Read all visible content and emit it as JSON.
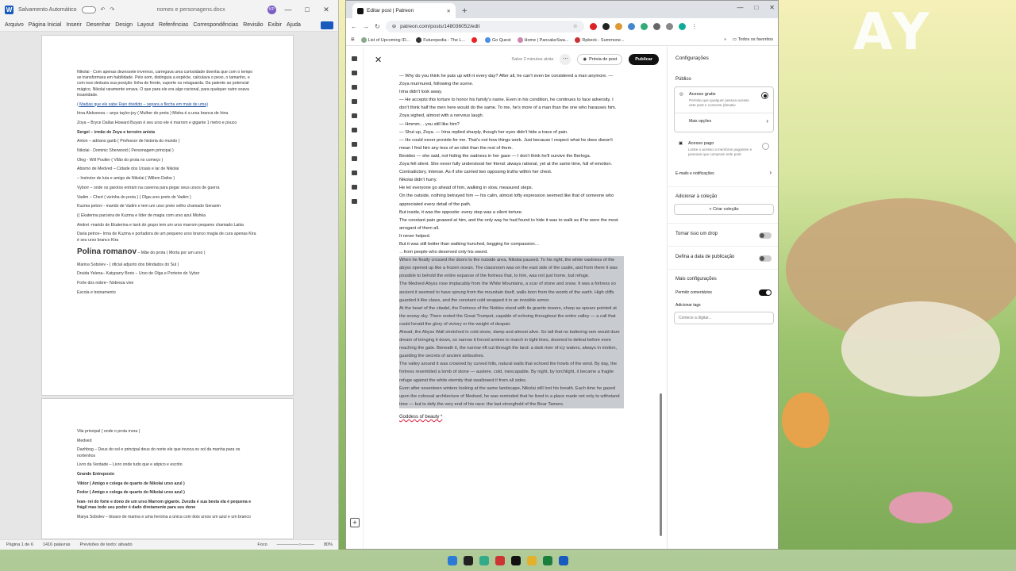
{
  "word": {
    "autosave_label": "Salvamento Automático",
    "doc_title": "nomes e personagens.docx",
    "user_initials": "KP",
    "menu": [
      "Arquivo",
      "Página Inicial",
      "Inserir",
      "Desenhar",
      "Design",
      "Layout",
      "Referências",
      "Correspondências",
      "Revisão",
      "Exibir",
      "Ajuda"
    ],
    "page1": [
      {
        "t": "Nikolai - Com apenas dezessete invernos, carregava uma curiosidade doentia que com o tempo se transformara em habilidade. Pelo som, distinguia a espécie, calculava o peso, o tamanho, e com isso deduzia sua posição: linha de frente, suporte ou retaguarda. Da patente ao potencial mágico, Nikolai raramente errava. O que para ele era algo racional, para qualquer outro soava insanidade.",
        "c": ""
      },
      {
        "t": "( Madias que ele sabe Raio dividido – separa a flecha em mais de uma)",
        "c": "u"
      },
      {
        "t": "Irina Aleksееva – anya taylor-joy  ( Mulher do prota )  Misha é a ursa branca de Irina",
        "c": ""
      },
      {
        "t": "Zoya – Bryce Dallas Howard  Buyan é seu urso ele é marrom e gigante 1 metro e pouco",
        "c": ""
      },
      {
        "t": "Sergei – irmão de Zoya e terceiro anista",
        "c": "b"
      },
      {
        "t": "Anton – adriano garib ( Professor de historia do mundo )",
        "c": ""
      },
      {
        "t": "Nikolai - Dominic Sherwood  ( Personagem principal )",
        "c": ""
      },
      {
        "t": "Oleg - Will Poulter ( Vilão do prota no começo )",
        "c": ""
      },
      {
        "t": "Abismo de Medved – Cidade dos Ursais e lar de Nikolai",
        "c": ""
      },
      {
        "t": "– Instrutor de luta e amigo de Nikolai ( Willem Dafoe )",
        "c": ""
      },
      {
        "t": "Vyborr – onde os garotos entram na caverna para pegar seus ursos de guerra",
        "c": ""
      },
      {
        "t": "Vadim – Chert ( vizinha do prota ) ( Olga urso preto de Vadim )",
        "c": ""
      },
      {
        "t": "Kuzma petrov - marido de Vadim e tem um urso preto velho chamado Gerasim",
        "c": ""
      },
      {
        "t": "(( Ekaterina  parceira de Kuzma e líder de magia com urso azul  Mishka",
        "c": ""
      },
      {
        "t": "   Andrei  -marido de Ekaterina e tank do grupo tem um urso marrom pequeno chamado Laika",
        "c": ""
      },
      {
        "t": " Daria petrov– Irma de Kuzma e portadora de um pequeno urso branco magia de cura apenas Kira é seu urso branco Kira",
        "c": ""
      },
      {
        "t": "Polina romanov",
        "c": "h",
        "s": " – Mãe do prota ( Morta por um urso )"
      },
      {
        "t": "Marina Sobolev -       ( oficial adjunto dos blindados do Sul )",
        "c": ""
      },
      {
        "t": "Druida Yelena– Katyparry  Boris – Urso de Olga e Porteiro do Vybor",
        "c": ""
      },
      {
        "t": "Forte dos nobre– Nobreza vive",
        "c": ""
      },
      {
        "t": "Escola e treinamento",
        "c": ""
      }
    ],
    "page2": [
      {
        "t": "Vila principal ( onde o prota mora )",
        "c": ""
      },
      {
        "t": "Medved",
        "c": ""
      },
      {
        "t": "Dazhbog – Deus do sol e principal deus do norte ele que invoca os sol da manha para os nortenhos",
        "c": ""
      },
      {
        "t": "Livro da Verdade – Livro onde tudo que e atipico e escrito",
        "c": ""
      },
      {
        "t": "Grande Entreposto",
        "c": "b"
      },
      {
        "t": "Viktor ( Amigo e colega de quarto de Nikolai urso azul )",
        "c": "b"
      },
      {
        "t": "Fedor ( Amigo e colega de quarto do Nikolai urso azul )",
        "c": "b"
      },
      {
        "t": "Ivan- rei do forte e dono de um urso Marrom gigante. Zvezda é sua besta ela é pequena e frágil mas todo seu poder é dado diretamente para seu dono",
        "c": "b"
      },
      {
        "t": "Marya Sobolev – bisavo de marina e uma heroina a única com dois ursos um azul e um branco",
        "c": ""
      }
    ],
    "status": {
      "page": "Página 1 de 6",
      "words": "1416 palavras",
      "predict": "Previsões de texto: ativado",
      "focus": "Foco",
      "zoom": "80%"
    }
  },
  "browser": {
    "tab_title": "Editar post | Patreon",
    "url": "patreon.com/posts/148036052/edit",
    "bookmarks": [
      "List of Upcoming ID...",
      "Futurepedia - The L...",
      "Go Quest",
      "Home | PancakeSwa...",
      "Rpbeck - Summone..."
    ],
    "bookmarks_folder": "Todos os favoritos",
    "saved_label": "Salvo 2 minutos atrás",
    "preview_label": "Prévia do post",
    "publish_label": "Publicar",
    "paragraphs": [
      "— Why do you think he puts up with it every day? After all, he can't even be considered a man anymore. — Zoya murmured, following the scene.",
      "Irina didn't look away.",
      "— He accepts this torture to honor his family's name. Even in his condition, he continues to face adversity. I don't think half the men here would do the same. To me, he's more of a man than the one who harasses him.",
      "Zoya sighed, almost with a nervous laugh.",
      "— Hmmm… you still like him?",
      "— Shut up, Zoya. — Irina replied sharply, though her eyes didn't hide a trace of pain.",
      "— He could never provide for me. That's not how things work. Just because I respect what he does doesn't mean I find him any less of an idiot than the rest of them.",
      "Besides — she said, not hiding the sadness in her gaze — I don't think he'll survive the Berloga.",
      "Zoya fell silent. She never fully understood her friend: always rational, yet at the same time, full of emotion. Contradictory. Intense. As if she carried two opposing truths within her chest.",
      "Nikolai didn't hurry.",
      "He let everyone go ahead of him, walking in slow, measured steps.",
      "On the outside, nothing betrayed him — his calm, almost lofty expression seemed like that of someone who appreciated every detail of the path.",
      "But inside, it was the opposite: every step was a silent torture.",
      "The constant pain gnawed at him, and the only way he had found to hide it was to walk as if he were the most arrogant of them all.",
      "It never helped.",
      "But it was still better than walking hunched, begging for compassion…",
      "…from people who deserved only his sword."
    ],
    "selected": [
      "When he finally crossed the doors to the outside area, Nikolai paused. To his right, the white vastness of the abyss opened up like a frozen ocean. The classroom was on the east side of the castle, and from there it was possible to behold the entire expanse of the fortress that, to him, was not just home, but refuge.",
      "The Medved Abyss rose implacably from the White Mountains, a scar of stone and snow. It was a fortress so ancient it seemed to have sprung from the mountain itself, walls born from the womb of the earth. High cliffs guarded it like claws, and the constant cold wrapped it in an invisible armor.",
      "At the heart of the citadel, the Fortress of the Nobles stood with its granite towers, sharp as spears pointed at the snowy sky. There rested the Great Trumpet, capable of echoing throughout the entire valley — a call that could herald the glory of victory or the weight of despair.",
      "Ahead, the Abyss Wall stretched in cold stone, damp and almost alive. So tall that no battering ram would dare dream of bringing it down, so narrow it forced armies to march in tight lines, doomed to defeat before even reaching the gate. Beneath it, the narrow rift cut through the land: a dark river of icy waters, always in motion, guarding the secrets of ancient ambushes.",
      "The valley around it was crowned by curved hills, natural walls that echoed the howls of the wind. By day, the fortress resembled a tomb of stone — austere, cold, inescapable. By night, by torchlight, it became a fragile refuge against the white eternity that swallowed it from all sides.",
      "Even after seventeen winters looking at the same landscape, Nikolai still lost his breath. Each time he gazed upon the colossal architecture of Medved, he was reminded that he lived in a place made not only to withstand time — but to defy the very end of his race: the last stronghold of the Bear Tamers."
    ],
    "goddess": "Goddess of beauty *",
    "settings": {
      "title": "Configurações",
      "public": "Público",
      "free_access": "Acesso gratis",
      "free_desc": "Permita que qualquer pessoa acesse este post e comente (desativ",
      "more_options": "Mais opções",
      "paid_access": "Acesso pago",
      "paid_desc": "Limite o acesso a membros pagantes e pessoas que compram este post.",
      "email": "E-mails e notificações",
      "add_collection": "Adicionar à coleção",
      "create_collection": "Criar coleção",
      "drop": "Tornar isso um drop",
      "schedule": "Defina a data de publicação",
      "more_settings": "Mais configurações",
      "allow_comments": "Permitir comentários",
      "add_tags": "Adicionar tags",
      "tags_placeholder": "Comece a digitar..."
    }
  },
  "colors": {
    "word_blue": "#185abd",
    "patreon_black": "#111111",
    "selection": "#c8cbd0"
  }
}
